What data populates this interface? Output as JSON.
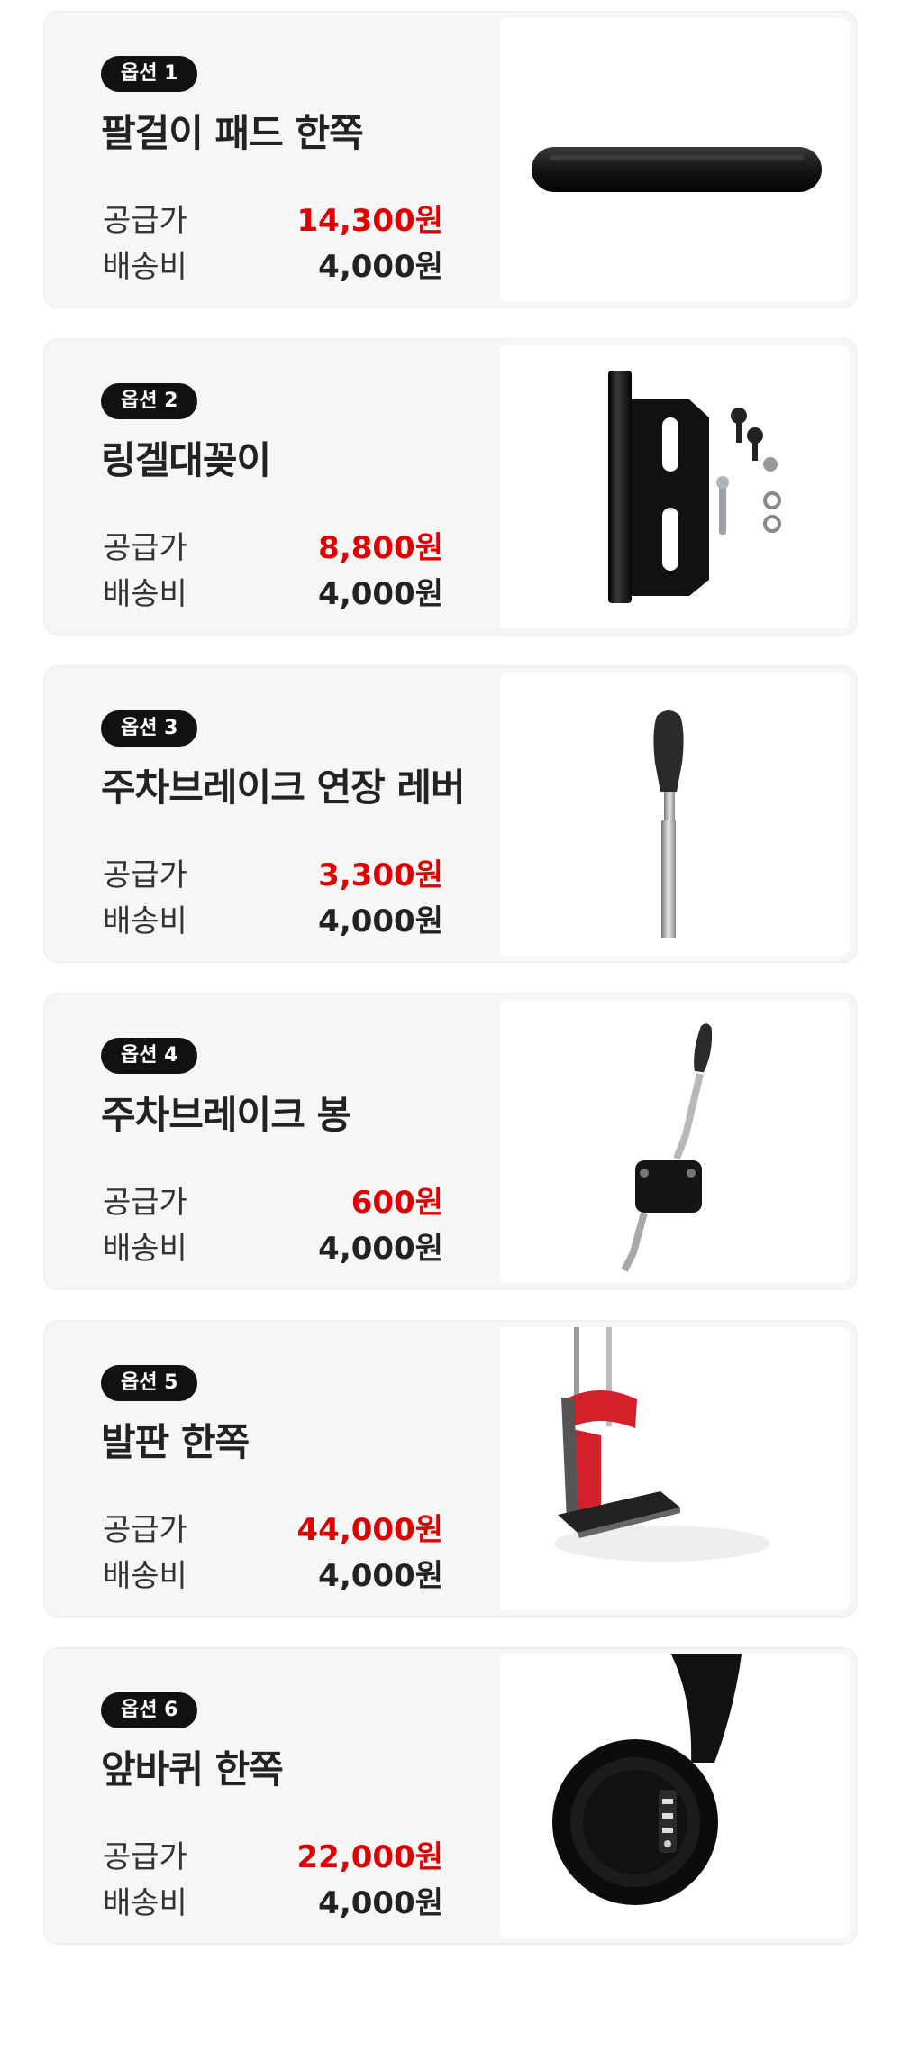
{
  "options": [
    {
      "badge": "옵션 1",
      "title": "팔걸이 패드 한쪽",
      "supply_label": "공급가",
      "supply_price": "14,300원",
      "shipping_label": "배송비",
      "shipping_price": "4,000원",
      "image_icon": "armrest-pad-icon"
    },
    {
      "badge": "옵션 2",
      "title": "링겔대꽂이",
      "supply_label": "공급가",
      "supply_price": "8,800원",
      "shipping_label": "배송비",
      "shipping_price": "4,000원",
      "image_icon": "iv-pole-holder-icon"
    },
    {
      "badge": "옵션 3",
      "title": "주차브레이크 연장 레버",
      "supply_label": "공급가",
      "supply_price": "3,300원",
      "shipping_label": "배송비",
      "shipping_price": "4,000원",
      "image_icon": "brake-extension-lever-icon"
    },
    {
      "badge": "옵션 4",
      "title": "주차브레이크 봉",
      "supply_label": "공급가",
      "supply_price": "600원",
      "shipping_label": "배송비",
      "shipping_price": "4,000원",
      "image_icon": "parking-brake-rod-icon"
    },
    {
      "badge": "옵션 5",
      "title": "발판 한쪽",
      "supply_label": "공급가",
      "supply_price": "44,000원",
      "shipping_label": "배송비",
      "shipping_price": "4,000원",
      "image_icon": "footrest-icon"
    },
    {
      "badge": "옵션 6",
      "title": "앞바퀴 한쪽",
      "supply_label": "공급가",
      "supply_price": "22,000원",
      "shipping_label": "배송비",
      "shipping_price": "4,000원",
      "image_icon": "front-wheel-icon"
    }
  ],
  "colors": {
    "price": "#e00000",
    "badge_bg": "#111111",
    "card_bg": "#f6f6f6"
  }
}
